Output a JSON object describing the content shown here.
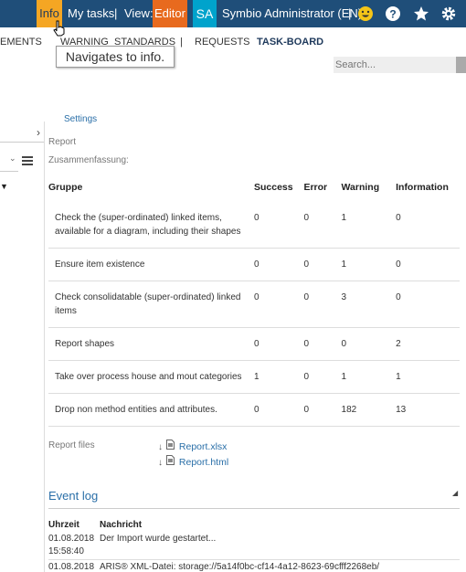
{
  "topbar": {
    "info": "Info",
    "my_tasks": "My tasks",
    "sep1": "|",
    "view_label": "View:",
    "editor": "Editor",
    "avatar": "SA",
    "user": "Symbio Administrator (EN)",
    "sep2": "|",
    "colors": {
      "bar": "#1f4e79",
      "info_bg": "#f5a623",
      "editor_bg": "#e86a1e",
      "avatar_bg": "#00a3cc"
    }
  },
  "subnav": {
    "elements": "EMENTS",
    "warning": "WARNING",
    "standards": "STANDARDS",
    "sep": "|",
    "requests": "REQUESTS",
    "taskboard": "TASK-BOARD"
  },
  "tooltip": "Navigates to info.",
  "search": {
    "placeholder": "Search..."
  },
  "main": {
    "settings_link": "Settings",
    "report_label": "Report",
    "summary_label": "Zusammenfassung:"
  },
  "summary_table": {
    "headers": [
      "Gruppe",
      "Success",
      "Error",
      "Warning",
      "Information"
    ],
    "rows": [
      {
        "group": "Check the (super-ordinated) linked items, available for a diagram, including their shapes",
        "success": "0",
        "error": "0",
        "warning": "1",
        "information": "0"
      },
      {
        "group": "Ensure item existence",
        "success": "0",
        "error": "0",
        "warning": "1",
        "information": "0"
      },
      {
        "group": "Check consolidatable (super-ordinated) linked items",
        "success": "0",
        "error": "0",
        "warning": "3",
        "information": "0"
      },
      {
        "group": "Report shapes",
        "success": "0",
        "error": "0",
        "warning": "0",
        "information": "2"
      },
      {
        "group": "Take over process house and mout categories",
        "success": "1",
        "error": "0",
        "warning": "1",
        "information": "1"
      },
      {
        "group": "Drop non method entities and attributes.",
        "success": "0",
        "error": "0",
        "warning": "182",
        "information": "13"
      }
    ]
  },
  "report_files": {
    "label": "Report files",
    "files": [
      "Report.xlsx",
      "Report.html"
    ]
  },
  "event_log": {
    "title": "Event log",
    "headers": [
      "Uhrzeit",
      "Nachricht"
    ],
    "entries": [
      {
        "date": "01.08.2018",
        "time": "15:58:40",
        "message": "Der Import wurde gestartet..."
      },
      {
        "date": "01.08.2018",
        "message": "ARIS® XML-Datei: storage://5a14f0bc-cf14-4a12-8623-69cfff2268eb/"
      }
    ]
  }
}
